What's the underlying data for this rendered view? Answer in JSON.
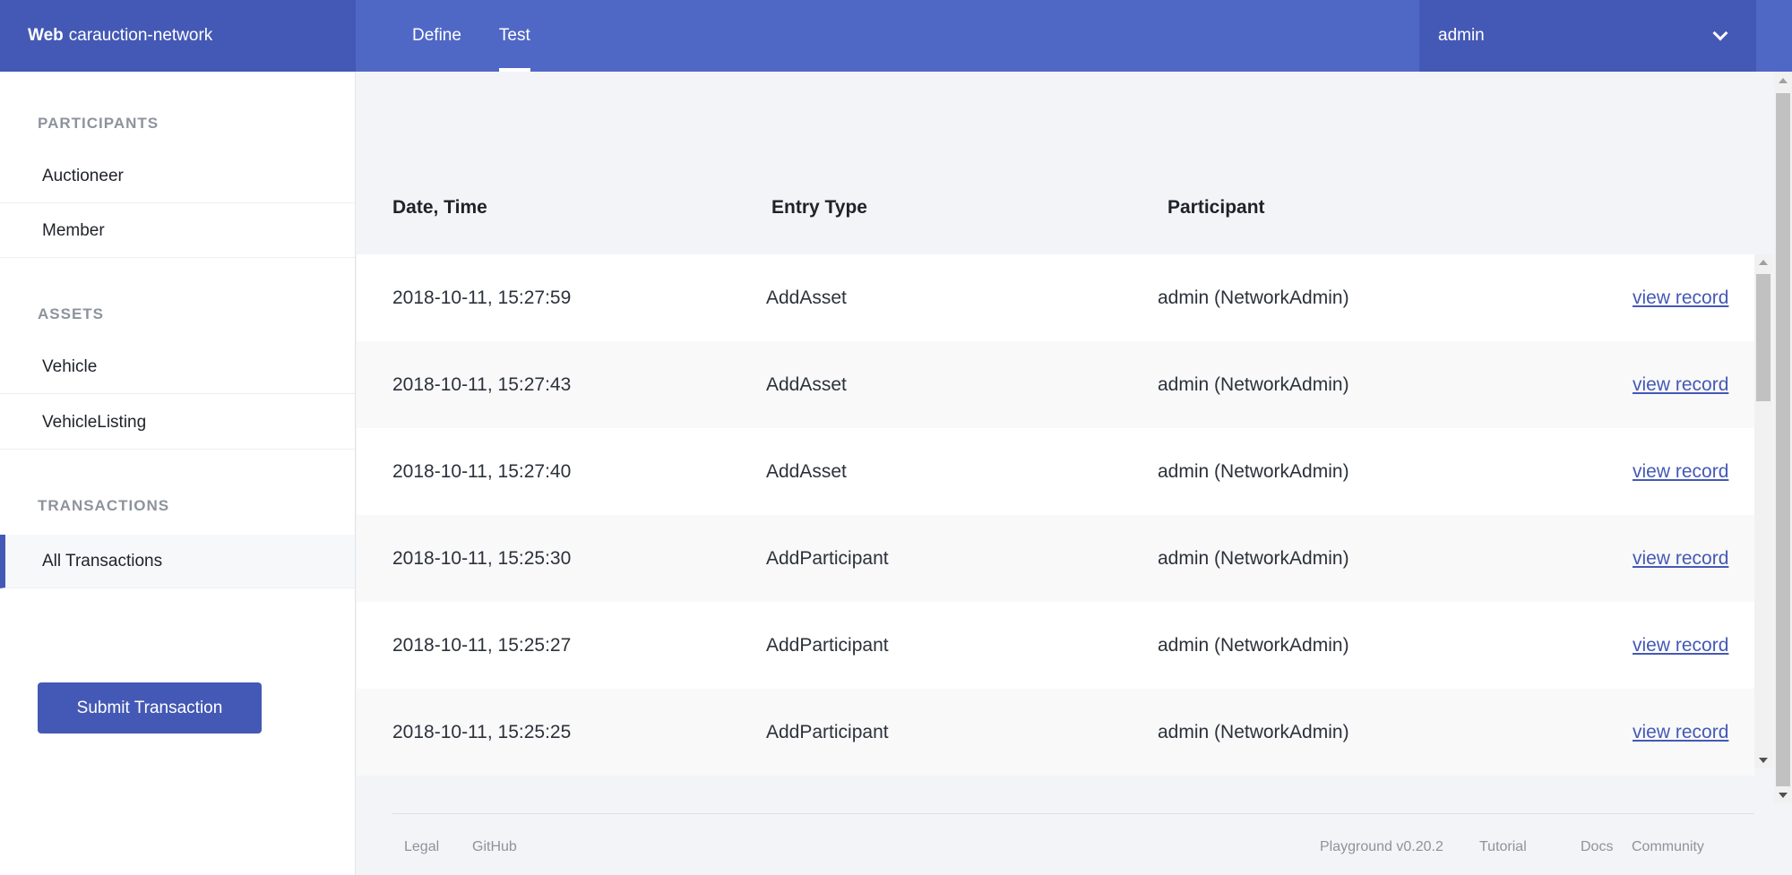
{
  "header": {
    "brand_strong": "Web",
    "brand_name": "carauction-network",
    "tabs": [
      {
        "label": "Define"
      },
      {
        "label": "Test"
      }
    ],
    "user": "admin"
  },
  "sidebar": {
    "sections": [
      {
        "title": "PARTICIPANTS",
        "items": [
          {
            "label": "Auctioneer"
          },
          {
            "label": "Member"
          }
        ]
      },
      {
        "title": "ASSETS",
        "items": [
          {
            "label": "Vehicle"
          },
          {
            "label": "VehicleListing"
          }
        ]
      },
      {
        "title": "TRANSACTIONS",
        "items": [
          {
            "label": "All Transactions"
          }
        ]
      }
    ],
    "submit_label": "Submit Transaction"
  },
  "table": {
    "columns": [
      "Date, Time",
      "Entry Type",
      "Participant"
    ],
    "rows": [
      {
        "datetime": "2018-10-11, 15:27:59",
        "entry_type": "AddAsset",
        "participant": "admin (NetworkAdmin)",
        "action": "view record"
      },
      {
        "datetime": "2018-10-11, 15:27:43",
        "entry_type": "AddAsset",
        "participant": "admin (NetworkAdmin)",
        "action": "view record"
      },
      {
        "datetime": "2018-10-11, 15:27:40",
        "entry_type": "AddAsset",
        "participant": "admin (NetworkAdmin)",
        "action": "view record"
      },
      {
        "datetime": "2018-10-11, 15:25:30",
        "entry_type": "AddParticipant",
        "participant": "admin (NetworkAdmin)",
        "action": "view record"
      },
      {
        "datetime": "2018-10-11, 15:25:27",
        "entry_type": "AddParticipant",
        "participant": "admin (NetworkAdmin)",
        "action": "view record"
      },
      {
        "datetime": "2018-10-11, 15:25:25",
        "entry_type": "AddParticipant",
        "participant": "admin (NetworkAdmin)",
        "action": "view record"
      }
    ]
  },
  "footer": {
    "left": [
      "Legal",
      "GitHub"
    ],
    "version": "Playground v0.20.2",
    "right": [
      "Tutorial",
      "Docs",
      "Community"
    ]
  },
  "colors": {
    "topbar": "#5068c5",
    "topbar_dark": "#4459b5",
    "accent": "#4459b5"
  }
}
